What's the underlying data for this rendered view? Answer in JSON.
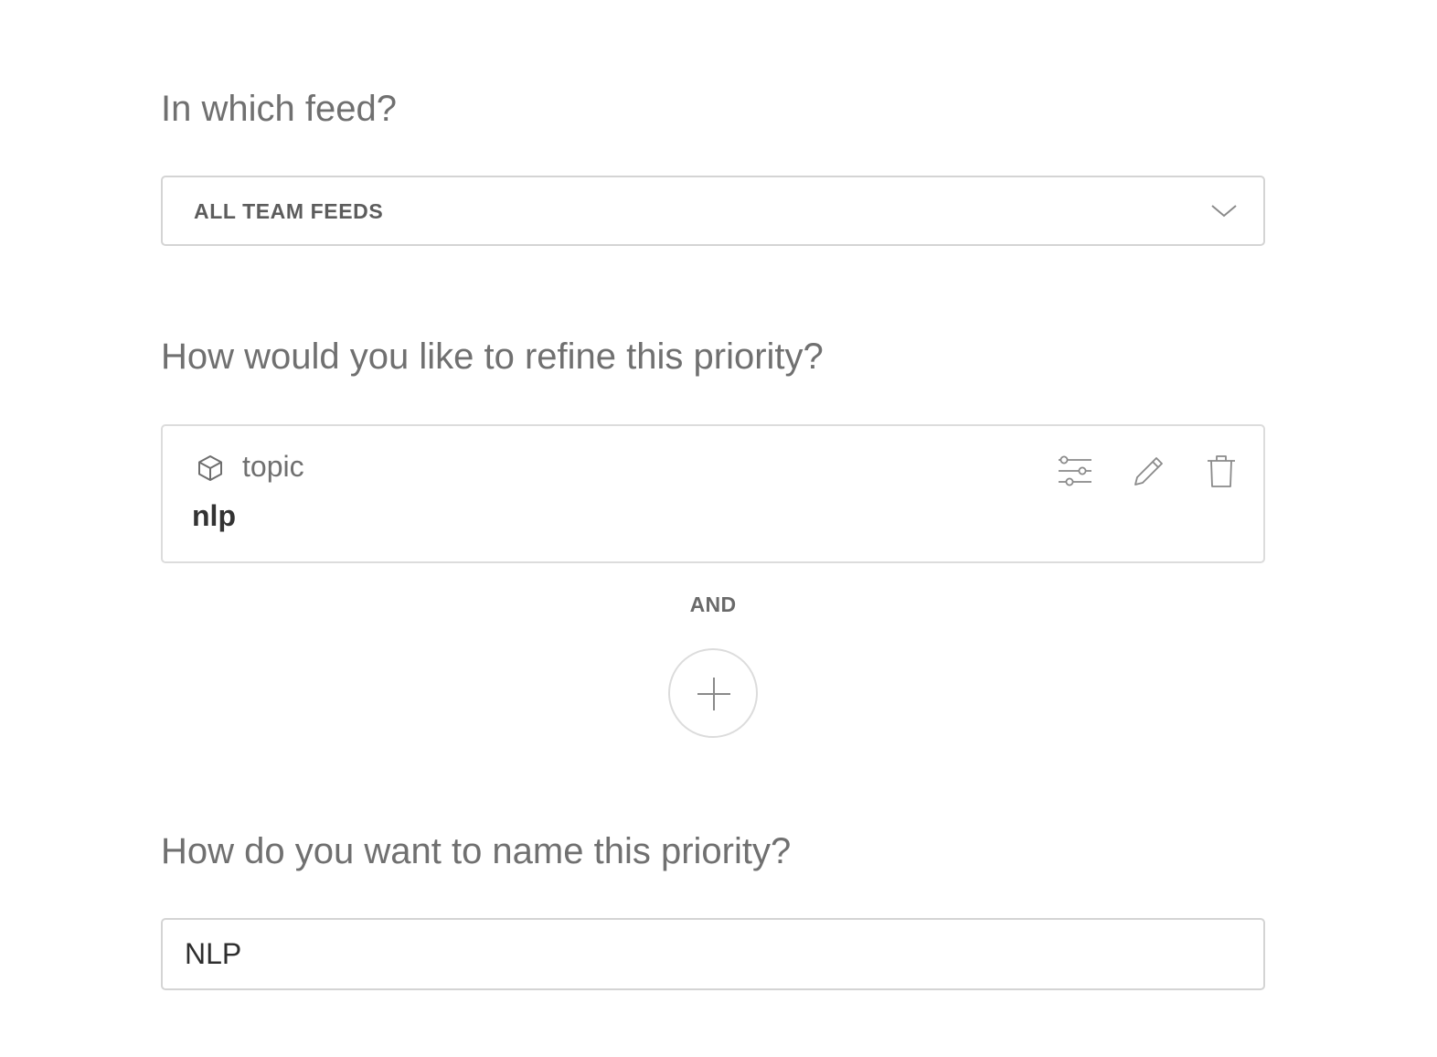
{
  "feed_section": {
    "question": "In which feed?",
    "selected_feed": "ALL TEAM FEEDS"
  },
  "refine_section": {
    "question": "How would you like to refine this priority?",
    "filters": [
      {
        "type_label": "topic",
        "type_icon": "cube-icon",
        "value": "nlp",
        "actions": [
          "sliders-icon",
          "pencil-icon",
          "trash-icon"
        ]
      }
    ],
    "connector": "AND",
    "add_icon": "plus-icon"
  },
  "name_section": {
    "question": "How do you want to name this priority?",
    "name_value": "NLP"
  }
}
